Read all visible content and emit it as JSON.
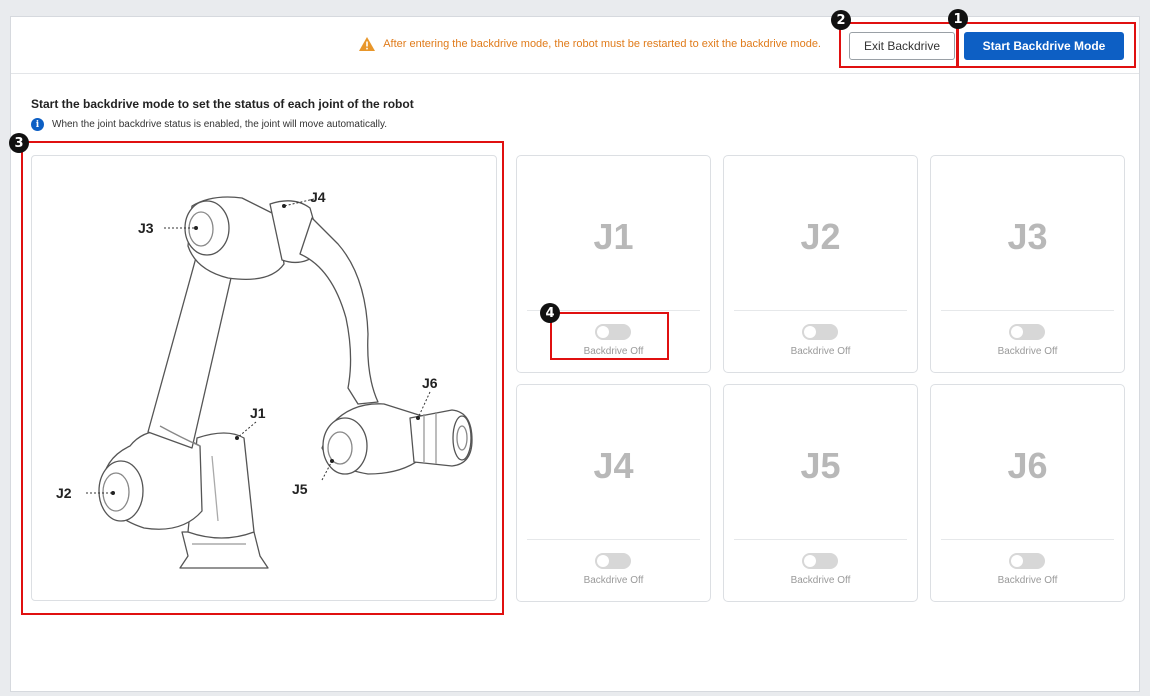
{
  "header": {
    "warning": "After entering the backdrive mode, the robot must be restarted to exit the backdrive mode.",
    "exit_button": "Exit Backdrive",
    "start_button": "Start Backdrive Mode"
  },
  "section": {
    "title": "Start the backdrive mode to set the status of each joint of the robot",
    "info": "When the joint backdrive status is enabled, the joint will move automatically."
  },
  "robot": {
    "labels": [
      "J1",
      "J2",
      "J3",
      "J4",
      "J5",
      "J6"
    ]
  },
  "joints": [
    {
      "name": "J1",
      "status": "Backdrive Off",
      "enabled": false
    },
    {
      "name": "J2",
      "status": "Backdrive Off",
      "enabled": false
    },
    {
      "name": "J3",
      "status": "Backdrive Off",
      "enabled": false
    },
    {
      "name": "J4",
      "status": "Backdrive Off",
      "enabled": false
    },
    {
      "name": "J5",
      "status": "Backdrive Off",
      "enabled": false
    },
    {
      "name": "J6",
      "status": "Backdrive Off",
      "enabled": false
    }
  ],
  "callouts": [
    "1",
    "2",
    "3",
    "4"
  ],
  "colors": {
    "accent": "#0d5fc4",
    "warning": "#e07b1a",
    "highlight": "#e01010",
    "disabled_text": "#b8b8b8"
  }
}
